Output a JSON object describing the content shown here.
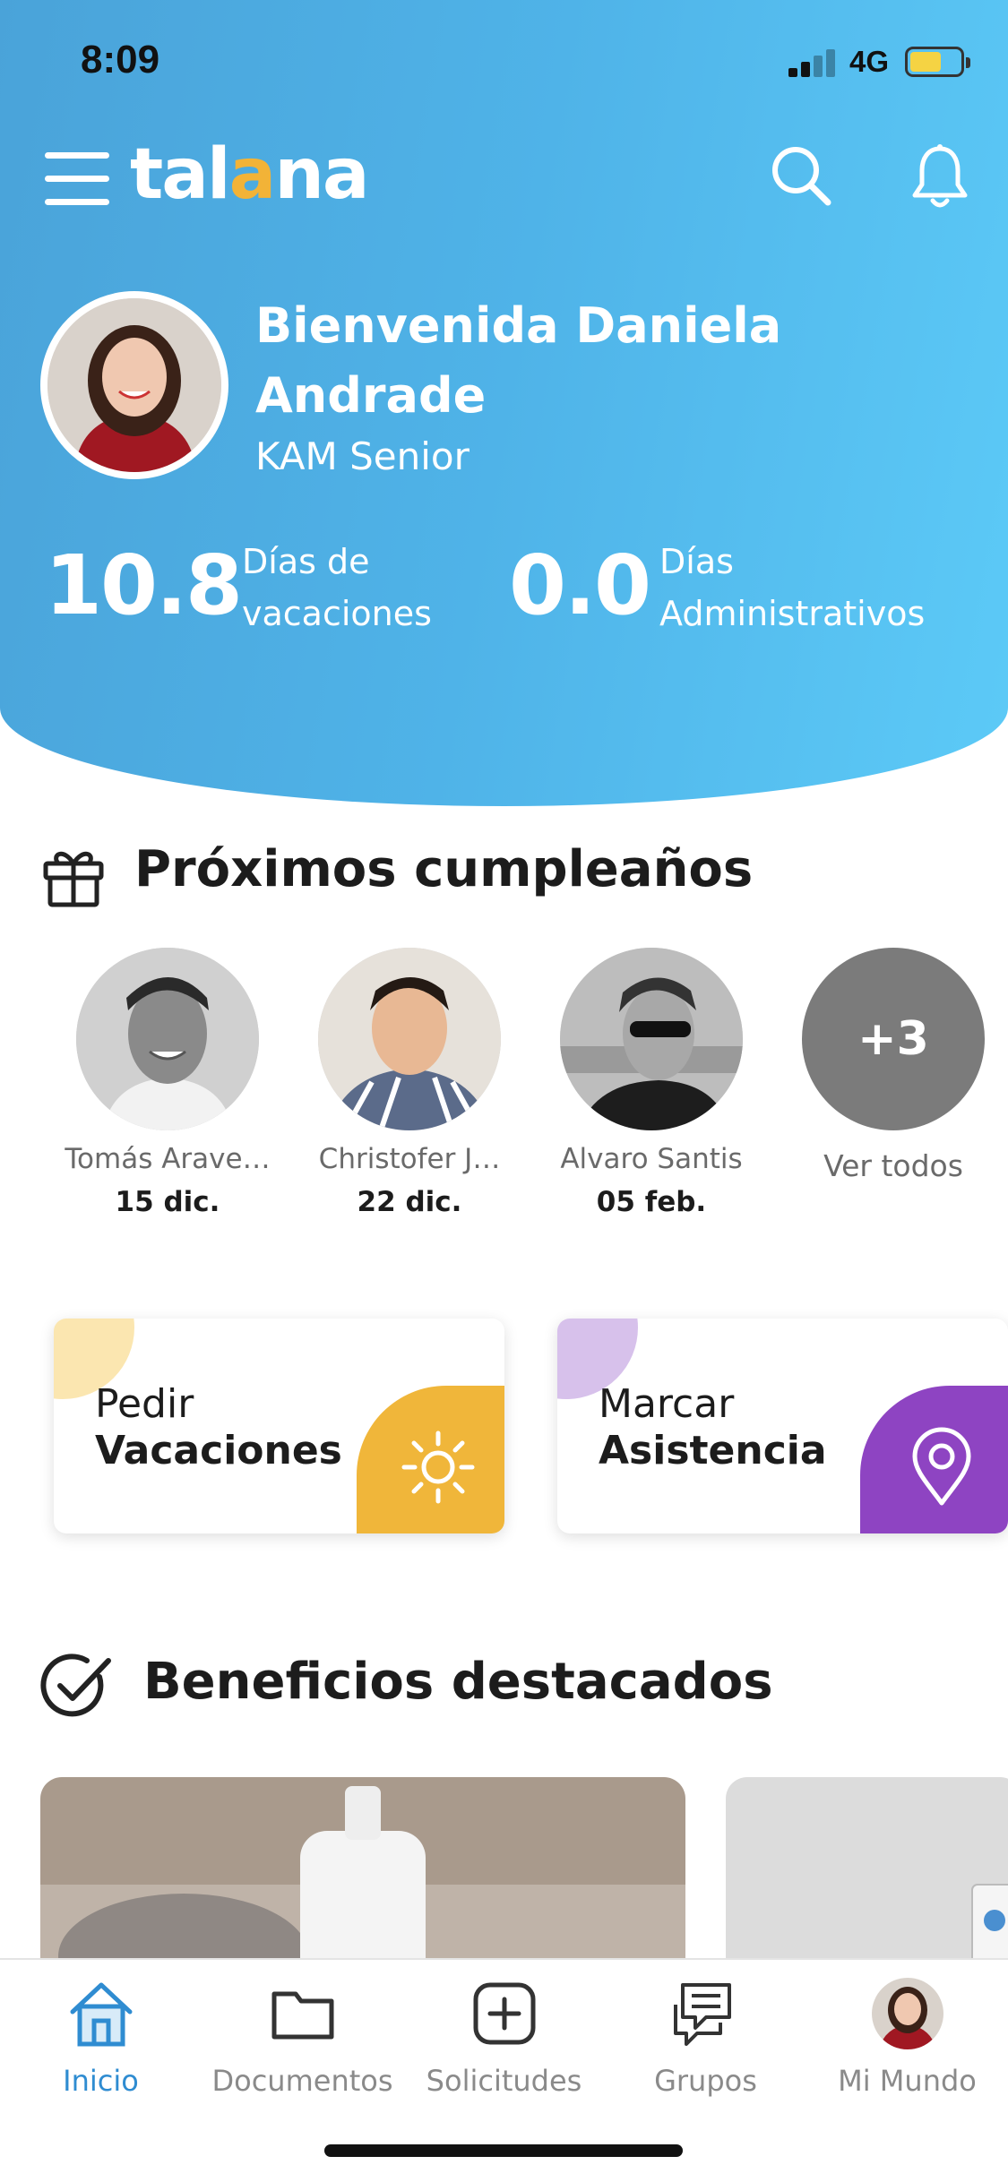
{
  "status_bar": {
    "time": "8:09",
    "network": "4G"
  },
  "header": {
    "logo_pre": "tal",
    "logo_accent": "a",
    "logo_post": "na",
    "welcome": "Bienvenida Daniela Andrade",
    "role": "KAM Senior",
    "stats": [
      {
        "value": "10.8",
        "label": "Días de vacaciones"
      },
      {
        "value": "0.0",
        "label": "Días Administrativos"
      }
    ]
  },
  "birthdays": {
    "title": "Próximos cumpleaños",
    "people": [
      {
        "name": "Tomás Arave…",
        "date": "15 dic."
      },
      {
        "name": "Christofer J…",
        "date": "22 dic."
      },
      {
        "name": "Alvaro Santis",
        "date": "05 feb."
      }
    ],
    "more_count": "+3",
    "more_label": "Ver todos"
  },
  "actions": [
    {
      "line1": "Pedir",
      "line2": "Vacaciones",
      "color": "#f0b63a",
      "corner": "#fbe6b0"
    },
    {
      "line1": "Marcar",
      "line2": "Asistencia",
      "color": "#8e44c2",
      "corner": "#d7c1eb"
    }
  ],
  "benefits": {
    "title": "Beneficios destacados"
  },
  "tabs": [
    {
      "label": "Inicio",
      "icon": "home-icon",
      "active": true
    },
    {
      "label": "Documentos",
      "icon": "folder-icon"
    },
    {
      "label": "Solicitudes",
      "icon": "plus-square-icon"
    },
    {
      "label": "Grupos",
      "icon": "chat-icon"
    },
    {
      "label": "Mi Mundo",
      "icon": "profile-avatar"
    }
  ],
  "colors": {
    "accent": "#2f8cd1",
    "logo_accent": "#f2b337",
    "header_start": "#4aa3d9",
    "header_end": "#5ccaf7"
  }
}
